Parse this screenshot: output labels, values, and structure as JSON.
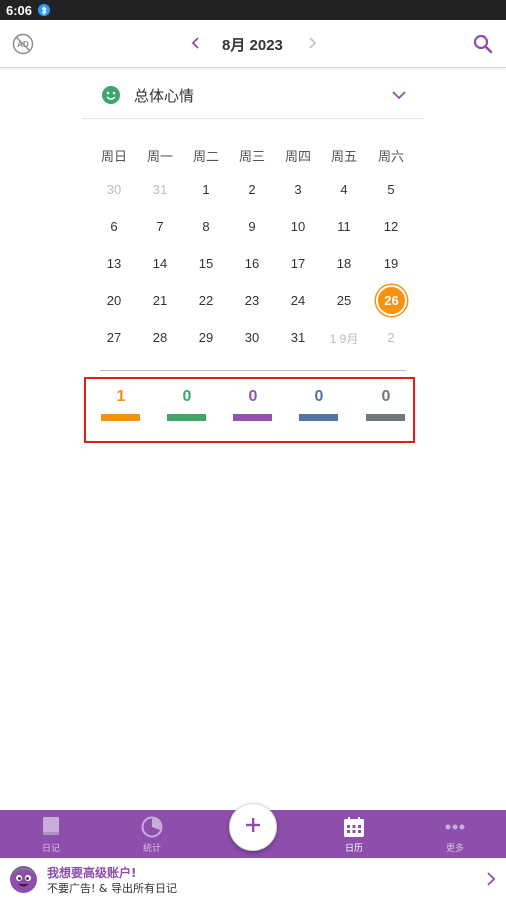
{
  "status_bar": {
    "time": "6:06"
  },
  "header": {
    "month_title": "8月 2023"
  },
  "mood_selector": {
    "label": "总体心情"
  },
  "calendar": {
    "weekdays": [
      "周日",
      "周一",
      "周二",
      "周三",
      "周四",
      "周五",
      "周六"
    ],
    "weeks": [
      [
        "30",
        "31",
        "1",
        "2",
        "3",
        "4",
        "5"
      ],
      [
        "6",
        "7",
        "8",
        "9",
        "10",
        "11",
        "12"
      ],
      [
        "13",
        "14",
        "15",
        "16",
        "17",
        "18",
        "19"
      ],
      [
        "20",
        "21",
        "22",
        "23",
        "24",
        "25",
        "26"
      ],
      [
        "27",
        "28",
        "29",
        "30",
        "31",
        "1 9月",
        "2"
      ]
    ],
    "today": "26"
  },
  "mood_counts": [
    {
      "value": "1",
      "color": "#f7910f"
    },
    {
      "value": "0",
      "color": "#3fa66a"
    },
    {
      "value": "0",
      "color": "#9253ad"
    },
    {
      "value": "0",
      "color": "#5474a1"
    },
    {
      "value": "0",
      "color": "#6d7a79"
    }
  ],
  "bottom_nav": {
    "items": [
      {
        "label": "日记",
        "icon": "book-icon"
      },
      {
        "label": "统计",
        "icon": "stats-icon"
      },
      {
        "label": "日历",
        "icon": "calendar-icon"
      },
      {
        "label": "更多",
        "icon": "more-icon"
      }
    ],
    "active": "日历",
    "add_icon": "plus-icon"
  },
  "promo": {
    "title": "我想要高级账户!",
    "subtitle": "不要广告! & 导出所有日记"
  },
  "colors": {
    "accent": "#8e4eab",
    "today": "#f7910f",
    "highlight_box": "#e51b1b"
  }
}
